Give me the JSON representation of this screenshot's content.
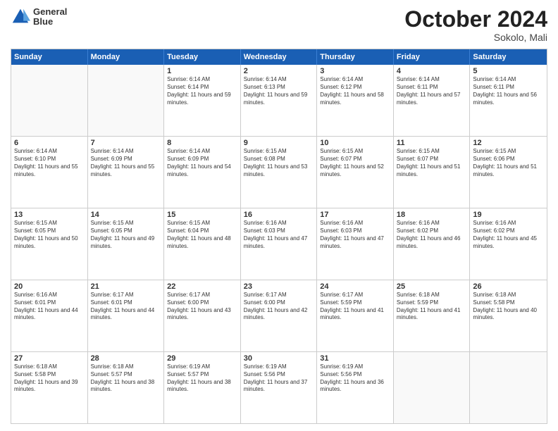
{
  "header": {
    "logo_line1": "General",
    "logo_line2": "Blue",
    "month": "October 2024",
    "location": "Sokolo, Mali"
  },
  "days_of_week": [
    "Sunday",
    "Monday",
    "Tuesday",
    "Wednesday",
    "Thursday",
    "Friday",
    "Saturday"
  ],
  "rows": [
    [
      {
        "day": "",
        "info": "",
        "empty": true
      },
      {
        "day": "",
        "info": "",
        "empty": true
      },
      {
        "day": "1",
        "info": "Sunrise: 6:14 AM\nSunset: 6:14 PM\nDaylight: 11 hours and 59 minutes."
      },
      {
        "day": "2",
        "info": "Sunrise: 6:14 AM\nSunset: 6:13 PM\nDaylight: 11 hours and 59 minutes."
      },
      {
        "day": "3",
        "info": "Sunrise: 6:14 AM\nSunset: 6:12 PM\nDaylight: 11 hours and 58 minutes."
      },
      {
        "day": "4",
        "info": "Sunrise: 6:14 AM\nSunset: 6:11 PM\nDaylight: 11 hours and 57 minutes."
      },
      {
        "day": "5",
        "info": "Sunrise: 6:14 AM\nSunset: 6:11 PM\nDaylight: 11 hours and 56 minutes."
      }
    ],
    [
      {
        "day": "6",
        "info": "Sunrise: 6:14 AM\nSunset: 6:10 PM\nDaylight: 11 hours and 55 minutes."
      },
      {
        "day": "7",
        "info": "Sunrise: 6:14 AM\nSunset: 6:09 PM\nDaylight: 11 hours and 55 minutes."
      },
      {
        "day": "8",
        "info": "Sunrise: 6:14 AM\nSunset: 6:09 PM\nDaylight: 11 hours and 54 minutes."
      },
      {
        "day": "9",
        "info": "Sunrise: 6:15 AM\nSunset: 6:08 PM\nDaylight: 11 hours and 53 minutes."
      },
      {
        "day": "10",
        "info": "Sunrise: 6:15 AM\nSunset: 6:07 PM\nDaylight: 11 hours and 52 minutes."
      },
      {
        "day": "11",
        "info": "Sunrise: 6:15 AM\nSunset: 6:07 PM\nDaylight: 11 hours and 51 minutes."
      },
      {
        "day": "12",
        "info": "Sunrise: 6:15 AM\nSunset: 6:06 PM\nDaylight: 11 hours and 51 minutes."
      }
    ],
    [
      {
        "day": "13",
        "info": "Sunrise: 6:15 AM\nSunset: 6:05 PM\nDaylight: 11 hours and 50 minutes."
      },
      {
        "day": "14",
        "info": "Sunrise: 6:15 AM\nSunset: 6:05 PM\nDaylight: 11 hours and 49 minutes."
      },
      {
        "day": "15",
        "info": "Sunrise: 6:15 AM\nSunset: 6:04 PM\nDaylight: 11 hours and 48 minutes."
      },
      {
        "day": "16",
        "info": "Sunrise: 6:16 AM\nSunset: 6:03 PM\nDaylight: 11 hours and 47 minutes."
      },
      {
        "day": "17",
        "info": "Sunrise: 6:16 AM\nSunset: 6:03 PM\nDaylight: 11 hours and 47 minutes."
      },
      {
        "day": "18",
        "info": "Sunrise: 6:16 AM\nSunset: 6:02 PM\nDaylight: 11 hours and 46 minutes."
      },
      {
        "day": "19",
        "info": "Sunrise: 6:16 AM\nSunset: 6:02 PM\nDaylight: 11 hours and 45 minutes."
      }
    ],
    [
      {
        "day": "20",
        "info": "Sunrise: 6:16 AM\nSunset: 6:01 PM\nDaylight: 11 hours and 44 minutes."
      },
      {
        "day": "21",
        "info": "Sunrise: 6:17 AM\nSunset: 6:01 PM\nDaylight: 11 hours and 44 minutes."
      },
      {
        "day": "22",
        "info": "Sunrise: 6:17 AM\nSunset: 6:00 PM\nDaylight: 11 hours and 43 minutes."
      },
      {
        "day": "23",
        "info": "Sunrise: 6:17 AM\nSunset: 6:00 PM\nDaylight: 11 hours and 42 minutes."
      },
      {
        "day": "24",
        "info": "Sunrise: 6:17 AM\nSunset: 5:59 PM\nDaylight: 11 hours and 41 minutes."
      },
      {
        "day": "25",
        "info": "Sunrise: 6:18 AM\nSunset: 5:59 PM\nDaylight: 11 hours and 41 minutes."
      },
      {
        "day": "26",
        "info": "Sunrise: 6:18 AM\nSunset: 5:58 PM\nDaylight: 11 hours and 40 minutes."
      }
    ],
    [
      {
        "day": "27",
        "info": "Sunrise: 6:18 AM\nSunset: 5:58 PM\nDaylight: 11 hours and 39 minutes."
      },
      {
        "day": "28",
        "info": "Sunrise: 6:18 AM\nSunset: 5:57 PM\nDaylight: 11 hours and 38 minutes."
      },
      {
        "day": "29",
        "info": "Sunrise: 6:19 AM\nSunset: 5:57 PM\nDaylight: 11 hours and 38 minutes."
      },
      {
        "day": "30",
        "info": "Sunrise: 6:19 AM\nSunset: 5:56 PM\nDaylight: 11 hours and 37 minutes."
      },
      {
        "day": "31",
        "info": "Sunrise: 6:19 AM\nSunset: 5:56 PM\nDaylight: 11 hours and 36 minutes."
      },
      {
        "day": "",
        "info": "",
        "empty": true
      },
      {
        "day": "",
        "info": "",
        "empty": true
      }
    ]
  ]
}
